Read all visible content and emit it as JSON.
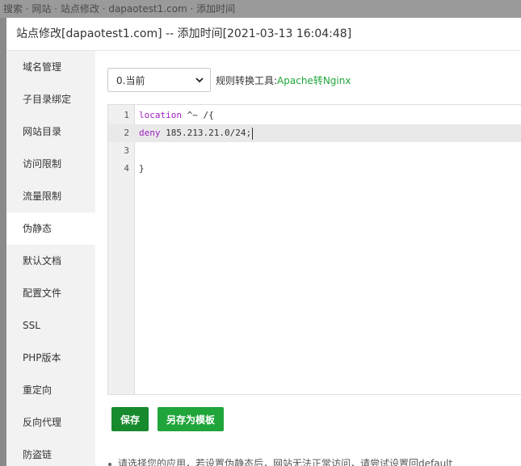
{
  "background": {
    "strip_text": "搜索 · 网站 · 站点修改 · dapaotest1.com · 添加时间"
  },
  "modal": {
    "title": "站点修改[dapaotest1.com] -- 添加时间[2021-03-13 16:04:48]"
  },
  "sidebar": {
    "items": [
      {
        "label": "域名管理"
      },
      {
        "label": "子目录绑定"
      },
      {
        "label": "网站目录"
      },
      {
        "label": "访问限制"
      },
      {
        "label": "流量限制"
      },
      {
        "label": "伪静态"
      },
      {
        "label": "默认文档"
      },
      {
        "label": "配置文件"
      },
      {
        "label": "SSL"
      },
      {
        "label": "PHP版本"
      },
      {
        "label": "重定向"
      },
      {
        "label": "反向代理"
      },
      {
        "label": "防盗链"
      }
    ],
    "active_index": 5
  },
  "toolbar": {
    "select_value": "0.当前",
    "select_icon": "chevron-down-icon",
    "converter_label": "规则转换工具:",
    "converter_link": "Apache转Nginx"
  },
  "editor": {
    "lines": [
      {
        "num": "1",
        "keyword": "location",
        "rest": " ^~ /{"
      },
      {
        "num": "2",
        "keyword": "deny",
        "rest": " 185.213.21.0/24;"
      },
      {
        "num": "3",
        "keyword": "",
        "rest": ""
      },
      {
        "num": "4",
        "keyword": "",
        "rest": "}"
      }
    ],
    "active_line": 2
  },
  "buttons": {
    "save": "保存",
    "save_as_template": "另存为模板"
  },
  "tip": "请选择您的应用，若设置伪静态后，网站无法正常访问，请尝试设置回default",
  "colors": {
    "accent": "#20a53a",
    "accent_dark": "#188a2e",
    "keyword": "#a020c0"
  }
}
